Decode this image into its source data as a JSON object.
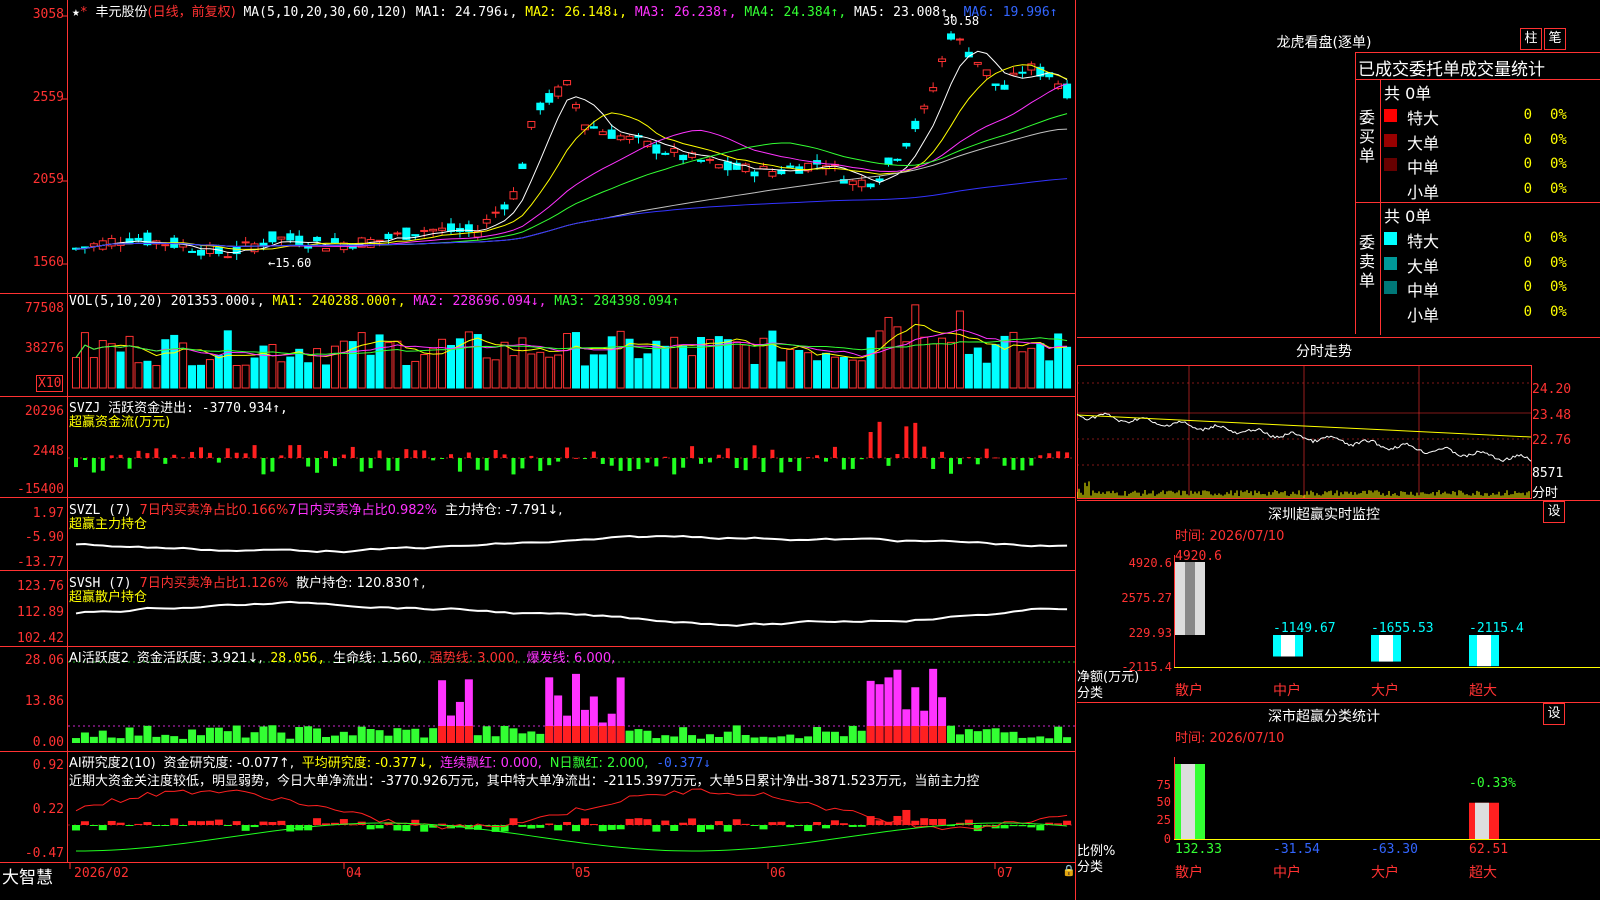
{
  "stock": {
    "name": "丰元股份",
    "mode": "(日线，前复权)"
  },
  "ma_header": {
    "params": "MA(5,10,20,30,60,120)",
    "ma1": "MA1: 24.796↓,",
    "ma2": "MA2: 26.148↓,",
    "ma3": "MA3: 26.238↑,",
    "ma4": "MA4: 24.384↑,",
    "ma5": "MA5: 23.008↑,",
    "ma6": "MA6: 19.996↑"
  },
  "price_axis": [
    "3058",
    "2559",
    "2059",
    "1560"
  ],
  "annotations": {
    "high": "30.58",
    "low": "←15.60"
  },
  "vol": {
    "params": "VOL(5,10,20)",
    "value": "201353.000↓,",
    "ma1": "MA1: 240288.000↑,",
    "ma2": "MA2: 228696.094↓,",
    "ma3": "MA3: 284398.094↑",
    "axis": [
      "77508",
      "38276"
    ],
    "unit": "X10"
  },
  "svzj": {
    "title": "SVZJ  活跃资金进出: -3770.934↑,",
    "subtitle": "超赢资金流(万元)",
    "axis": [
      "20296",
      "2448",
      "-15400"
    ]
  },
  "svzl": {
    "prefix": "SVZL (7)",
    "ratio1": "7日内买卖净占比0.166%",
    "ratio2": "7日内买卖净占比0.982%",
    "hold": "主力持仓: -7.791↓,",
    "subtitle": "超赢主力持仓",
    "axis": [
      "1.97",
      "-5.90",
      "-13.77"
    ]
  },
  "svsh": {
    "prefix": "SVSH (7)",
    "ratio": "7日内买卖净占比1.126%",
    "hold": "散户持仓: 120.830↑,",
    "subtitle": "超赢散户持仓",
    "axis": [
      "123.76",
      "112.89",
      "102.42"
    ]
  },
  "ai1": {
    "prefix": "AI活跃度2",
    "act": "资金活跃度: 3.921↓,",
    "v2": "28.056,",
    "life": "生命线: 1.560,",
    "strong": "强势线: 3.000,",
    "burst": "爆发线: 6.000,",
    "axis": [
      "28.06",
      "13.86",
      "0.00"
    ]
  },
  "ai2": {
    "prefix": "AI研究度2(10)",
    "research": "资金研究度: -0.077↑,",
    "avg": "平均研究度: -0.377↓,",
    "piao": "连续飘红: 0.000,",
    "npiao": "N日飘红: 2.000,",
    "v": "-0.377↓",
    "axis": [
      "0.92",
      "0.22",
      "-0.47"
    ],
    "summary": "近期大资金关注度较低，明显弱势，今日大单净流出：-3770.926万元，其中特大单净流出：-2115.397万元，大单5日累计净出-3871.523万元，当前主力控"
  },
  "date_axis": {
    "brand": "大智慧",
    "labels": [
      "2026/02",
      "04",
      "05",
      "06",
      "07"
    ]
  },
  "right": {
    "lhkp": {
      "title": "龙虎看盘(逐单)",
      "btn1": "柱",
      "btn2": "笔"
    },
    "order_stats": {
      "header": "已成交委托单成交量统计",
      "buy_label": "委买单",
      "sell_label": "委卖单",
      "buy_total": "共 0单",
      "sell_total": "共 0单",
      "buy_rows": [
        {
          "label": "特大",
          "count": "0",
          "pct": "0%",
          "color": "#ff0000"
        },
        {
          "label": "大单",
          "count": "0",
          "pct": "0%",
          "color": "#990000"
        },
        {
          "label": "中单",
          "count": "0",
          "pct": "0%",
          "color": "#660000"
        },
        {
          "label": "小单",
          "count": "0",
          "pct": "0%",
          "color": ""
        }
      ],
      "sell_rows": [
        {
          "label": "特大",
          "count": "0",
          "pct": "0%",
          "color": "#00ffff"
        },
        {
          "label": "大单",
          "count": "0",
          "pct": "0%",
          "color": "#009999"
        },
        {
          "label": "中单",
          "count": "0",
          "pct": "0%",
          "color": "#007777"
        },
        {
          "label": "小单",
          "count": "0",
          "pct": "0%",
          "color": ""
        }
      ]
    },
    "intraday": {
      "title": "分时走势",
      "axis": [
        "24.20",
        "23.48",
        "22.76"
      ],
      "vol": "8571",
      "vol_label": "分时"
    },
    "sz_monitor": {
      "title": "深圳超赢实时监控",
      "btn": "设",
      "time": "时间: 2026/07/10",
      "axis": [
        "4920.6",
        "2575.27",
        "229.93",
        "-2115.4"
      ],
      "values": [
        "4920.6",
        "-1149.67",
        "-1655.53",
        "-2115.4"
      ],
      "categories": [
        "散户",
        "中户",
        "大户",
        "超大"
      ],
      "ylabel": "净额(万元)",
      "xlabel": "分类"
    },
    "sz_class": {
      "title": "深市超赢分类统计",
      "btn": "设",
      "time": "时间: 2026/07/10",
      "axis": [
        "75",
        "50",
        "25",
        "0"
      ],
      "values": [
        "132.33",
        "-31.54",
        "-63.30",
        "62.51"
      ],
      "top_label": "-0.33%",
      "categories": [
        "散户",
        "中户",
        "大户",
        "超大"
      ],
      "ylabel": "比例%",
      "xlabel": "分类"
    }
  }
}
